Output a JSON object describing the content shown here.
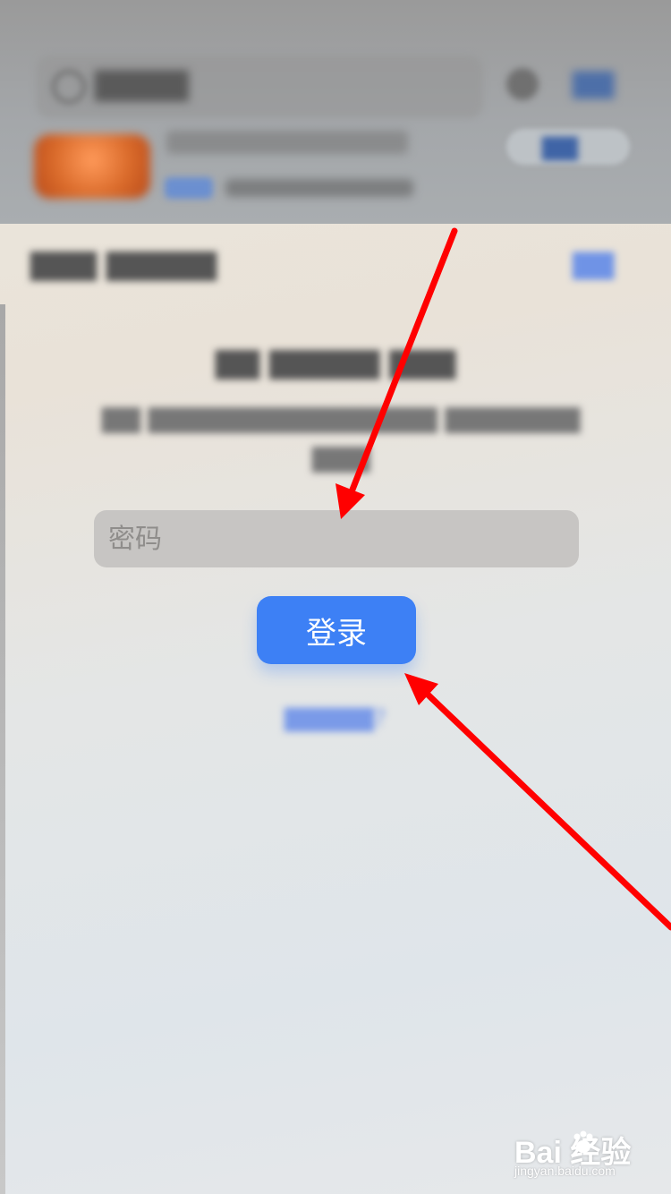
{
  "background_app": {
    "icons": [
      "search-icon",
      "microphone-icon",
      "app-icon"
    ]
  },
  "login_sheet": {
    "password_placeholder": "密码",
    "login_label": "登录"
  },
  "annotation": {
    "arrow_color": "#ff0000"
  },
  "colors": {
    "accent": "#3d80f5",
    "field_background": "#c7c5c3"
  }
}
